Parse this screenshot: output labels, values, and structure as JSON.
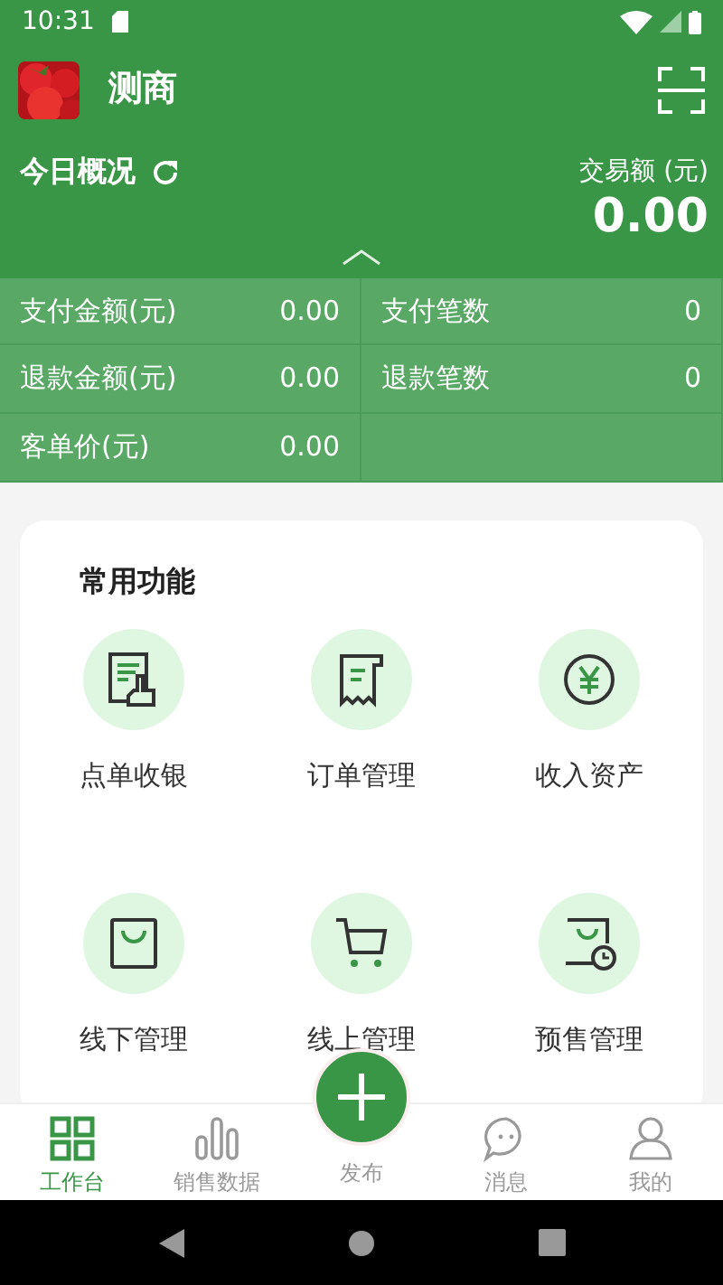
{
  "status_bar": {
    "time": "10:31"
  },
  "header": {
    "title": "测商"
  },
  "overview": {
    "title": "今日概况",
    "amount_label": "交易额 (元)",
    "amount": "0.00"
  },
  "stats": [
    {
      "label": "支付金额(元)",
      "value": "0.00"
    },
    {
      "label": "支付笔数",
      "value": "0"
    },
    {
      "label": "退款金额(元)",
      "value": "0.00"
    },
    {
      "label": "退款笔数",
      "value": "0"
    },
    {
      "label": "客单价(元)",
      "value": "0.00"
    }
  ],
  "functions": {
    "title": "常用功能",
    "items": [
      {
        "label": "点单收银"
      },
      {
        "label": "订单管理"
      },
      {
        "label": "收入资产"
      },
      {
        "label": "线下管理"
      },
      {
        "label": "线上管理"
      },
      {
        "label": "预售管理"
      }
    ]
  },
  "bottom_nav": [
    {
      "label": "工作台",
      "selected": true
    },
    {
      "label": "销售数据",
      "selected": false
    },
    {
      "label": "发布",
      "selected": false
    },
    {
      "label": "消息",
      "selected": false
    },
    {
      "label": "我的",
      "selected": false
    }
  ]
}
